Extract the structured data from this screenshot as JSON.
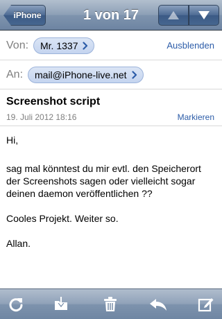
{
  "navbar": {
    "back_label": "iPhone",
    "title": "1 von 17",
    "prev_icon": "triangle-up-icon",
    "next_icon": "triangle-down-icon"
  },
  "header": {
    "from_label": "Von:",
    "from_value": "Mr. 1337",
    "hide_label": "Ausblenden",
    "to_label": "An:",
    "to_value": "mail@iPhone-live.net"
  },
  "message": {
    "subject": "Screenshot script",
    "date": "19. Juli 2012 18:16",
    "mark_label": "Markieren",
    "greeting": "Hi,",
    "paragraph1": "sag mal könntest du mir evtl. den Speicherort der Screenshots sagen oder vielleicht sogar deinen daemon veröffentlichen ??",
    "paragraph2": "Cooles Projekt. Weiter so.",
    "signature": "Allan."
  },
  "toolbar": {
    "icons": [
      "refresh-icon",
      "move-folder-icon",
      "trash-icon",
      "reply-icon",
      "compose-icon"
    ]
  },
  "colors": {
    "link": "#2c5ca8",
    "label_gray": "#7f7f7f",
    "pill_bg": "#c4d4ef",
    "navbar": "#6d84a2"
  }
}
